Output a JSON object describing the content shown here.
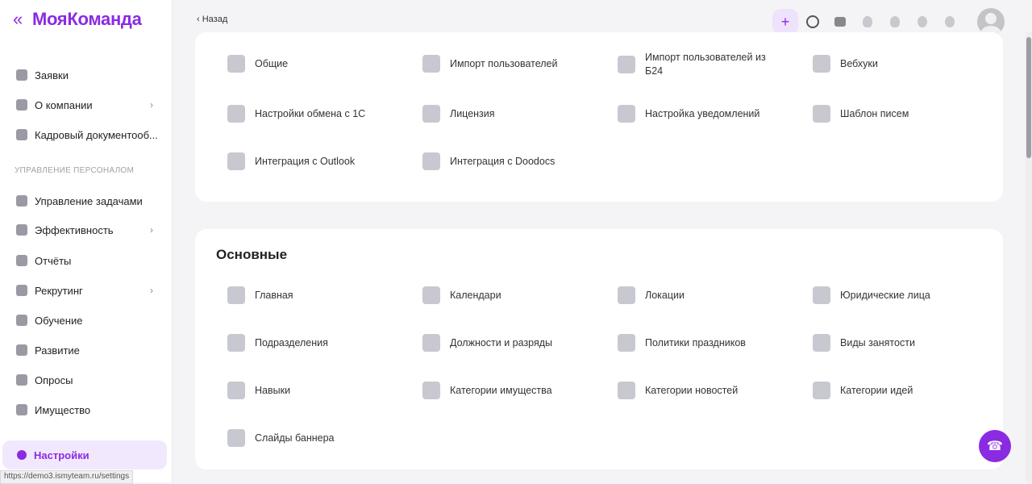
{
  "app": {
    "logo": "МояКоманда",
    "collapse_icon": "«"
  },
  "sidebar": {
    "items": [
      {
        "label": "Заявки",
        "has_arrow": false
      },
      {
        "label": "О компании",
        "has_arrow": true
      },
      {
        "label": "Кадровый документооб...",
        "has_arrow": false
      }
    ],
    "section_label": "УПРАВЛЕНИЕ ПЕРСОНАЛОМ",
    "section_items": [
      {
        "label": "Управление задачами",
        "has_arrow": false
      },
      {
        "label": "Эффективность",
        "has_arrow": true
      },
      {
        "label": "Отчёты",
        "has_arrow": false
      },
      {
        "label": "Рекрутинг",
        "has_arrow": true
      },
      {
        "label": "Обучение",
        "has_arrow": false
      },
      {
        "label": "Развитие",
        "has_arrow": false
      },
      {
        "label": "Опросы",
        "has_arrow": false
      },
      {
        "label": "Имущество",
        "has_arrow": false
      }
    ],
    "active_item": "Настройки"
  },
  "status_url": "https://demo3.ismyteam.ru/settings",
  "topbar": {
    "back_label": "Назад",
    "icons": [
      "plus-icon",
      "search-icon",
      "chat-icon",
      "idea-icon",
      "bell-icon",
      "help-icon",
      "settings-icon"
    ],
    "plus_label": "+"
  },
  "integrations": {
    "tiles": [
      {
        "label": "Общие",
        "icon": "grid-icon"
      },
      {
        "label": "Импорт пользователей",
        "icon": "upload-icon"
      },
      {
        "label": "Импорт пользователей из Б24",
        "icon": "upload-icon"
      },
      {
        "label": "Вебхуки",
        "icon": "webhook-icon"
      },
      {
        "label": "Настройки обмена с 1С",
        "icon": "exchange-icon"
      },
      {
        "label": "Лицензия",
        "icon": "license-icon"
      },
      {
        "label": "Настройка уведомлений",
        "icon": "bell-icon"
      },
      {
        "label": "Шаблон писем",
        "icon": "mail-icon"
      },
      {
        "label": "Интеграция с Outlook",
        "icon": "outlook-icon"
      },
      {
        "label": "Интеграция с Doodocs",
        "icon": "doodocs-icon"
      }
    ]
  },
  "main_section": {
    "title": "Основные",
    "tiles": [
      {
        "label": "Главная",
        "icon": "home-icon"
      },
      {
        "label": "Календари",
        "icon": "calendar-icon"
      },
      {
        "label": "Локации",
        "icon": "location-icon"
      },
      {
        "label": "Юридические лица",
        "icon": "building-icon"
      },
      {
        "label": "Подразделения",
        "icon": "departments-icon"
      },
      {
        "label": "Должности и разряды",
        "icon": "briefcase-icon"
      },
      {
        "label": "Политики праздников",
        "icon": "holiday-icon"
      },
      {
        "label": "Виды занятости",
        "icon": "edit-icon"
      },
      {
        "label": "Навыки",
        "icon": "skills-icon"
      },
      {
        "label": "Категории имущества",
        "icon": "property-icon"
      },
      {
        "label": "Категории новостей",
        "icon": "news-icon"
      },
      {
        "label": "Категории идей",
        "icon": "idea-icon"
      },
      {
        "label": "Слайды баннера",
        "icon": "banner-icon"
      }
    ]
  },
  "colors": {
    "accent": "#8a2be2",
    "active_bg": "#f2e8fd"
  }
}
